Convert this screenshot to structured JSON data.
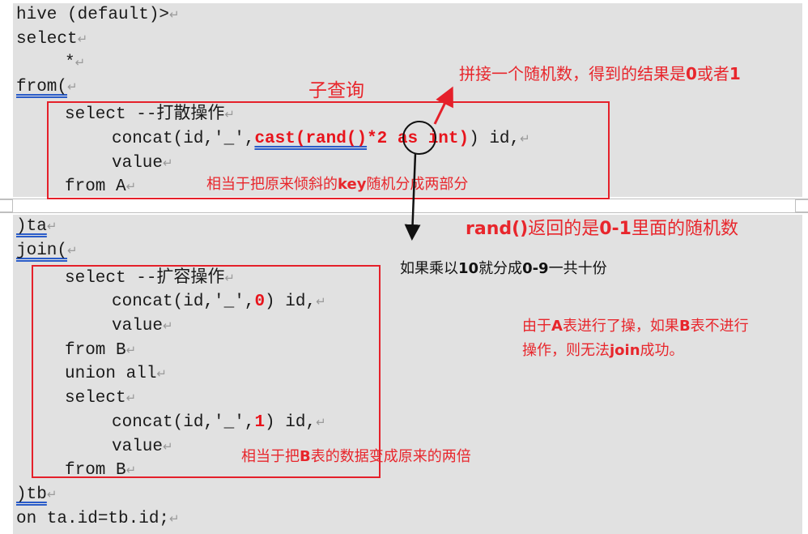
{
  "code": {
    "line1": "hive (default)>",
    "line2": "select",
    "line3": "*",
    "line4": "from(",
    "sub_a": {
      "select": "select --打散操作",
      "concat_pre": "concat(id,'_',",
      "cast_fn": "cast(rand()",
      "times2": "*2",
      "as_int": " as int)",
      "concat_post": ") id,",
      "value": "value",
      "from": "from A"
    },
    "ta": ")ta",
    "join": "join(",
    "sub_b": {
      "select1": "select --扩容操作",
      "concat1_pre": "concat(id,'_',",
      "concat1_num": "0",
      "concat1_post": ") id,",
      "value1": "value",
      "from1": "from B",
      "union": "union all",
      "select2": "select",
      "concat2_pre": "concat(id,'_',",
      "concat2_num": "1",
      "concat2_post": ") id,",
      "value2": "value",
      "from2": "from B"
    },
    "tb": ")tb",
    "on": "on ta.id=tb.id;",
    "para_mark": "↵"
  },
  "annotations": {
    "subquery": "子查询",
    "concat_random": {
      "pre": "拼接一个随机数，得到的结果是",
      "b1": "0",
      "mid": "或者",
      "b2": "1"
    },
    "scatter_key": {
      "pre": "相当于把原来倾斜的",
      "b": "key",
      "post": "随机分成两部分"
    },
    "rand_range": {
      "b1": "rand()",
      "mid1": "返回的是",
      "b2": "0-1",
      "post": "里面的随机数"
    },
    "times10": {
      "pre": "如果乘以",
      "b1": "10",
      "mid": "就分成",
      "b2": "0-9",
      "post": "一共十份"
    },
    "b_reason": {
      "l1_pre": "由于",
      "l1_b1": "A",
      "l1_mid": "表进行了操，如果",
      "l1_b2": "B",
      "l1_post": "表不进行",
      "l2_pre": "操作，则无法",
      "l2_b": "join",
      "l2_post": "成功。"
    },
    "b_double": {
      "pre": "相当于把",
      "b": "B",
      "post": "表的数据变成原来的两倍"
    }
  },
  "colors": {
    "accent_red": "#e5202a",
    "page_bg": "#e1e1e1",
    "underline_blue": "#2a5cc9"
  }
}
